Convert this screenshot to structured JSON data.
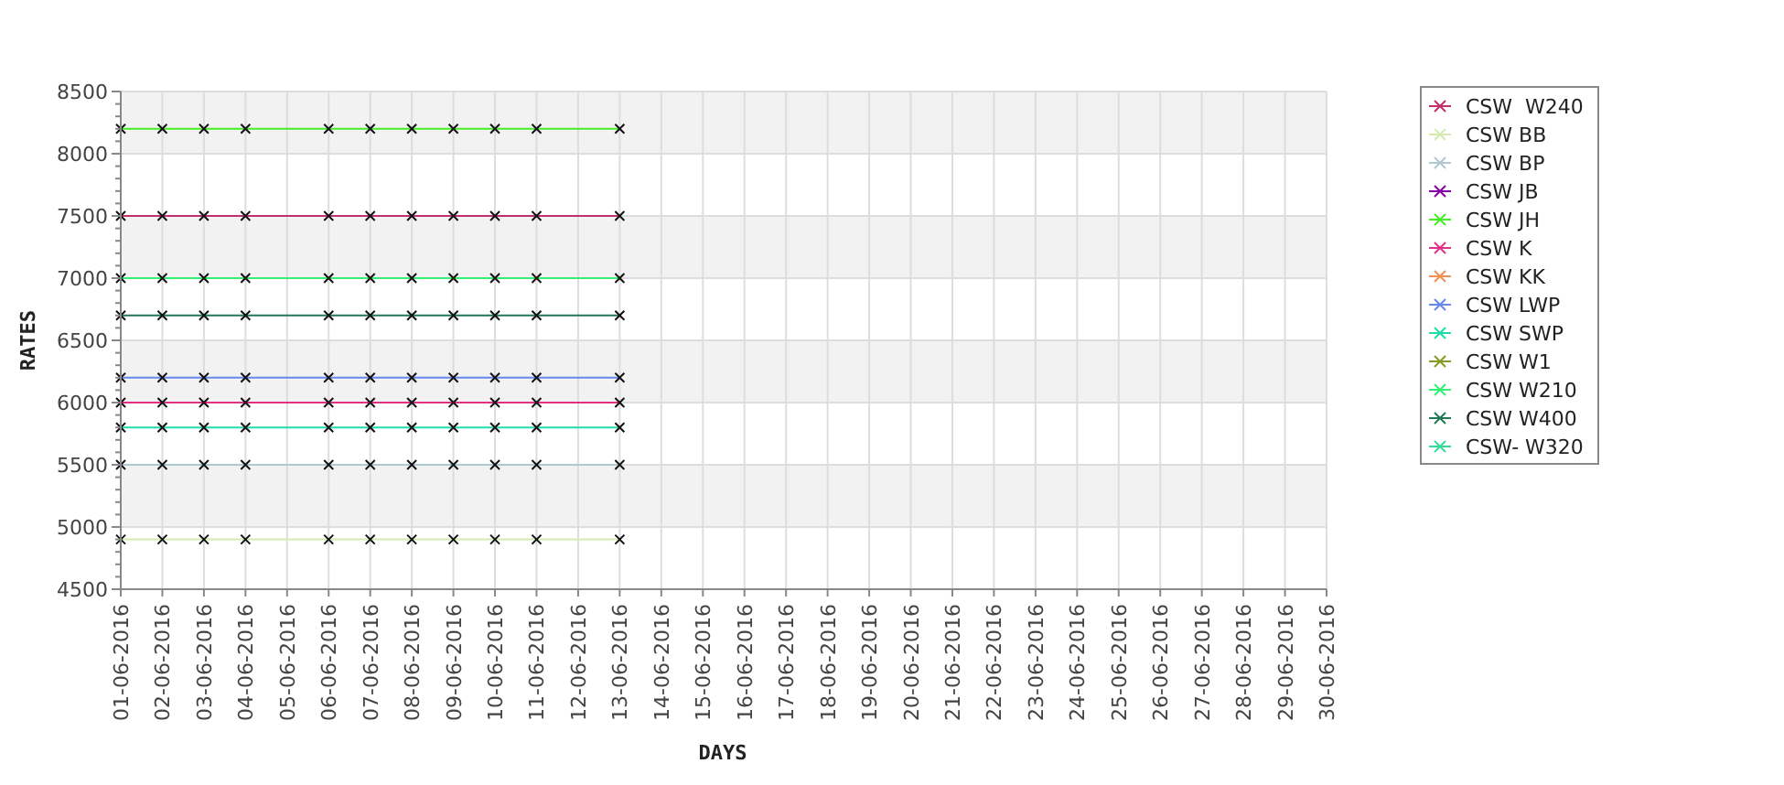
{
  "chart": {
    "chart_data": {
      "type": "line",
      "grid": true,
      "legend": true,
      "xlabel": "DAYS",
      "ylabel": "RATES",
      "ylim": [
        4500,
        8500
      ],
      "yticks": [
        4500,
        5000,
        5500,
        6000,
        6500,
        7000,
        7500,
        8000,
        8500
      ],
      "categories": [
        "01-06-2016",
        "02-06-2016",
        "03-06-2016",
        "04-06-2016",
        "05-06-2016",
        "06-06-2016",
        "07-06-2016",
        "08-06-2016",
        "09-06-2016",
        "10-06-2016",
        "11-06-2016",
        "12-06-2016",
        "13-06-2016",
        "14-06-2016",
        "15-06-2016",
        "16-06-2016",
        "17-06-2016",
        "18-06-2016",
        "19-06-2016",
        "20-06-2016",
        "21-06-2016",
        "22-06-2016",
        "23-06-2016",
        "24-06-2016",
        "25-06-2016",
        "26-06-2016",
        "27-06-2016",
        "28-06-2016",
        "29-06-2016",
        "30-06-2016"
      ],
      "series": [
        {
          "name": "CSW  W240",
          "color": "#c0306a",
          "marker": "x",
          "values": [
            7500,
            7500,
            7500,
            7500,
            null,
            7500,
            7500,
            7500,
            7500,
            7500,
            7500,
            null,
            7500,
            null,
            null,
            null,
            null,
            null,
            null,
            null,
            null,
            null,
            null,
            null,
            null,
            null,
            null,
            null,
            null,
            null
          ]
        },
        {
          "name": "CSW BB",
          "color": "#d4ecb0",
          "marker": "x",
          "values": [
            4900,
            4900,
            4900,
            4900,
            null,
            4900,
            4900,
            4900,
            4900,
            4900,
            4900,
            null,
            4900,
            null,
            null,
            null,
            null,
            null,
            null,
            null,
            null,
            null,
            null,
            null,
            null,
            null,
            null,
            null,
            null,
            null
          ]
        },
        {
          "name": "CSW BP",
          "color": "#b0c8d0",
          "marker": "x",
          "values": [
            5500,
            5500,
            5500,
            5500,
            null,
            5500,
            5500,
            5500,
            5500,
            5500,
            5500,
            null,
            5500,
            null,
            null,
            null,
            null,
            null,
            null,
            null,
            null,
            null,
            null,
            null,
            null,
            null,
            null,
            null,
            null,
            null
          ]
        },
        {
          "name": "CSW JB",
          "color": "#8800aa",
          "marker": "x",
          "values": [
            null,
            null,
            null,
            null,
            null,
            null,
            null,
            null,
            null,
            null,
            null,
            null,
            null,
            null,
            null,
            null,
            null,
            null,
            null,
            null,
            null,
            null,
            null,
            null,
            null,
            null,
            null,
            null,
            null,
            null
          ]
        },
        {
          "name": "CSW JH",
          "color": "#44ee22",
          "marker": "x",
          "values": [
            8200,
            8200,
            8200,
            8200,
            null,
            8200,
            8200,
            8200,
            8200,
            8200,
            8200,
            null,
            8200,
            null,
            null,
            null,
            null,
            null,
            null,
            null,
            null,
            null,
            null,
            null,
            null,
            null,
            null,
            null,
            null,
            null
          ]
        },
        {
          "name": "CSW K",
          "color": "#e0308a",
          "marker": "x",
          "values": [
            6000,
            6000,
            6000,
            6000,
            null,
            6000,
            6000,
            6000,
            6000,
            6000,
            6000,
            null,
            6000,
            null,
            null,
            null,
            null,
            null,
            null,
            null,
            null,
            null,
            null,
            null,
            null,
            null,
            null,
            null,
            null,
            null
          ]
        },
        {
          "name": "CSW KK",
          "color": "#f09050",
          "marker": "x",
          "values": [
            null,
            null,
            null,
            null,
            null,
            null,
            null,
            null,
            null,
            null,
            null,
            null,
            null,
            null,
            null,
            null,
            null,
            null,
            null,
            null,
            null,
            null,
            null,
            null,
            null,
            null,
            null,
            null,
            null,
            null
          ]
        },
        {
          "name": "CSW LWP",
          "color": "#6688ee",
          "marker": "x",
          "values": [
            6200,
            6200,
            6200,
            6200,
            null,
            6200,
            6200,
            6200,
            6200,
            6200,
            6200,
            null,
            6200,
            null,
            null,
            null,
            null,
            null,
            null,
            null,
            null,
            null,
            null,
            null,
            null,
            null,
            null,
            null,
            null,
            null
          ]
        },
        {
          "name": "CSW SWP",
          "color": "#22ddaa",
          "marker": "x",
          "values": [
            5800,
            5800,
            5800,
            5800,
            null,
            5800,
            5800,
            5800,
            5800,
            5800,
            5800,
            null,
            5800,
            null,
            null,
            null,
            null,
            null,
            null,
            null,
            null,
            null,
            null,
            null,
            null,
            null,
            null,
            null,
            null,
            null
          ]
        },
        {
          "name": "CSW W1",
          "color": "#889922",
          "marker": "x",
          "values": [
            null,
            null,
            null,
            null,
            null,
            null,
            null,
            null,
            null,
            null,
            null,
            null,
            null,
            null,
            null,
            null,
            null,
            null,
            null,
            null,
            null,
            null,
            null,
            null,
            null,
            null,
            null,
            null,
            null,
            null
          ]
        },
        {
          "name": "CSW W210",
          "color": "#33ee77",
          "marker": "x",
          "values": [
            7000,
            7000,
            7000,
            7000,
            null,
            7000,
            7000,
            7000,
            7000,
            7000,
            7000,
            null,
            7000,
            null,
            null,
            null,
            null,
            null,
            null,
            null,
            null,
            null,
            null,
            null,
            null,
            null,
            null,
            null,
            null,
            null
          ]
        },
        {
          "name": "CSW W400",
          "color": "#227755",
          "marker": "x",
          "values": [
            6700,
            6700,
            6700,
            6700,
            null,
            6700,
            6700,
            6700,
            6700,
            6700,
            6700,
            null,
            6700,
            null,
            null,
            null,
            null,
            null,
            null,
            null,
            null,
            null,
            null,
            null,
            null,
            null,
            null,
            null,
            null,
            null
          ]
        },
        {
          "name": "CSW- W320",
          "color": "#33dd99",
          "marker": "x",
          "values": [
            null,
            null,
            null,
            null,
            null,
            null,
            null,
            null,
            null,
            null,
            null,
            null,
            null,
            null,
            null,
            null,
            null,
            null,
            null,
            null,
            null,
            null,
            null,
            null,
            null,
            null,
            null,
            null,
            null,
            null
          ]
        }
      ]
    }
  }
}
